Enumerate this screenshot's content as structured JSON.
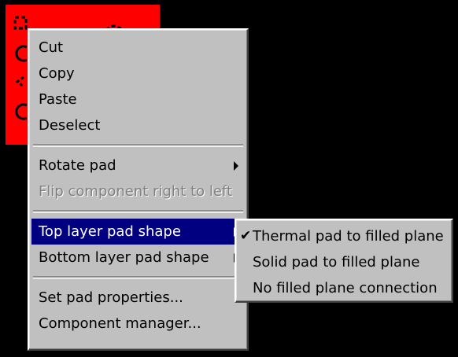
{
  "context_menu": {
    "items": [
      {
        "label": "Cut",
        "enabled": true
      },
      {
        "label": "Copy",
        "enabled": true
      },
      {
        "label": "Paste",
        "enabled": true
      },
      {
        "label": "Deselect",
        "enabled": true
      },
      {
        "label": "Rotate pad",
        "enabled": true,
        "has_submenu": true
      },
      {
        "label": "Flip component right to left",
        "enabled": false
      },
      {
        "label": "Top layer pad shape",
        "enabled": true,
        "has_submenu": true,
        "highlighted": true
      },
      {
        "label": "Bottom layer pad shape",
        "enabled": true,
        "has_submenu": true
      },
      {
        "label": "Set pad properties...",
        "enabled": true
      },
      {
        "label": "Component manager...",
        "enabled": true
      }
    ]
  },
  "submenu": {
    "items": [
      {
        "label": "Thermal pad to filled plane",
        "checked": true
      },
      {
        "label": "Solid pad to filled plane",
        "checked": false
      },
      {
        "label": "No filled plane connection",
        "checked": false
      }
    ],
    "check_glyph": "✔"
  },
  "colors": {
    "canvas": "#000000",
    "pad_region": "#ff0000",
    "menu_face": "#c0c0c0",
    "highlight": "#000080",
    "disabled_text": "#808080"
  }
}
